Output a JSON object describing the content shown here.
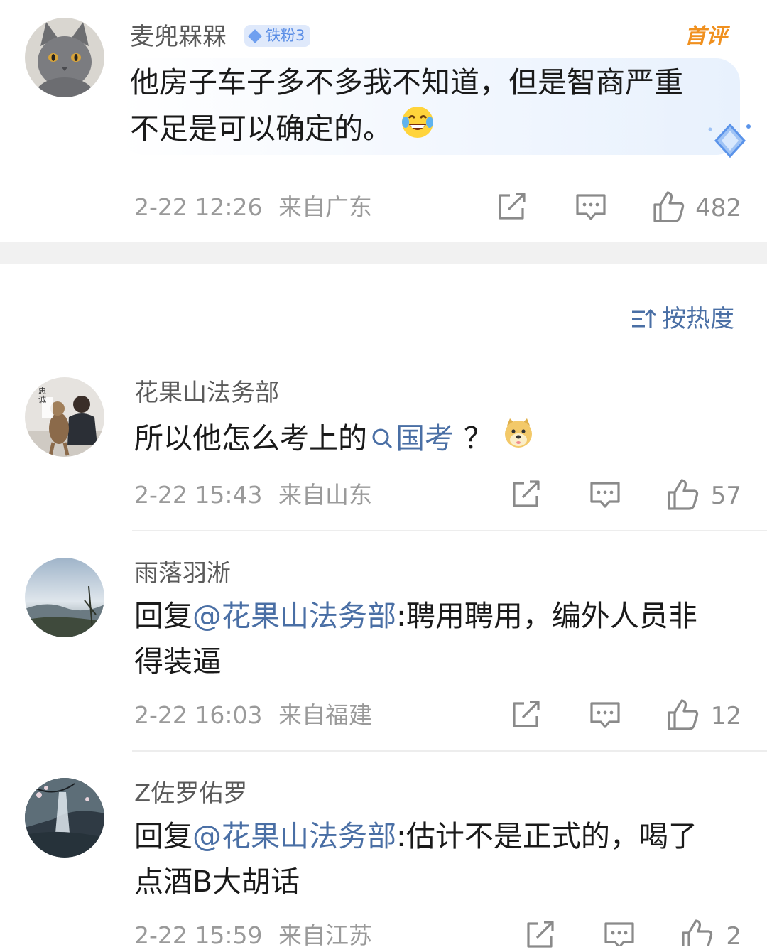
{
  "featured": {
    "username": "麦兜槑槑",
    "badge": "铁粉3",
    "tag": "首评",
    "text_line1": "他房子车子多不多我不知道，但是智商严重",
    "text_line2": "不足是可以确定的。",
    "time": "2-22 12:26",
    "location": "来自广东",
    "likes": "482"
  },
  "sort": {
    "label": "按热度"
  },
  "comments": [
    {
      "username": "花果山法务部",
      "text_before": "所以他怎么考上的",
      "topic": "国考",
      "text_after": "？",
      "time": "2-22 15:43",
      "location": "来自山东",
      "likes": "57"
    },
    {
      "username": "雨落羽淅",
      "reply_prefix": "回复",
      "mention": "@花果山法务部",
      "text_line1": ":聘用聘用，编外人员非",
      "text_line2": "得装逼",
      "time": "2-22 16:03",
      "location": "来自福建",
      "likes": "12"
    },
    {
      "username": "Z佐罗佑罗",
      "reply_prefix": "回复",
      "mention": "@花果山法务部",
      "text_line1": ":估计不是正式的，喝了",
      "text_line2": "点酒B大胡话",
      "time": "2-22 15:59",
      "location": "来自江苏",
      "likes": "2"
    }
  ],
  "avatar_label": "忠诚",
  "colors": {
    "link": "#4a6fa5",
    "meta": "#9a9a9a",
    "badge_bg": "#dfe9fb",
    "tag": "#f0901e"
  }
}
